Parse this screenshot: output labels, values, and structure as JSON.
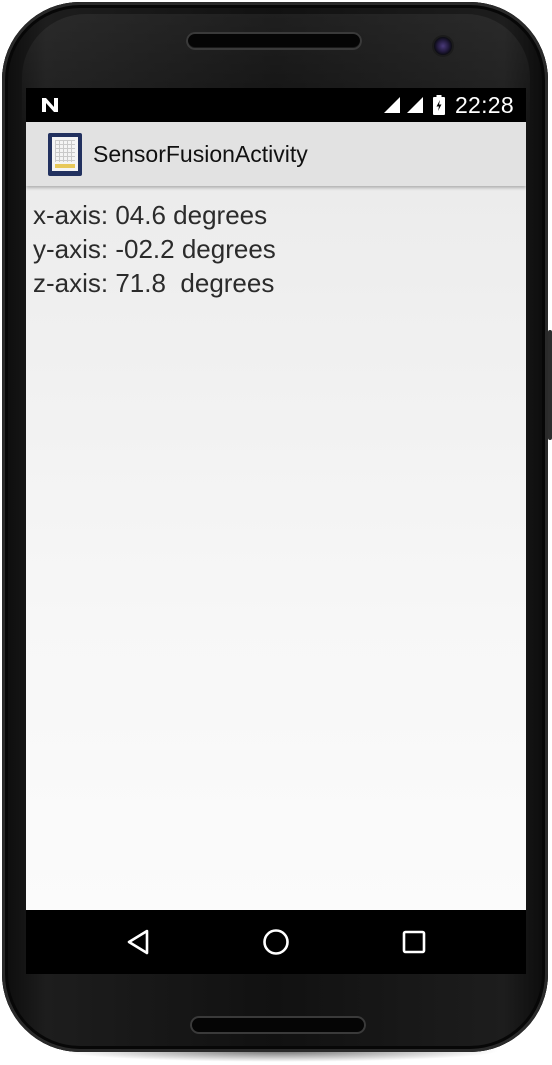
{
  "status_bar": {
    "time": "22:28"
  },
  "action_bar": {
    "title": "SensorFusionActivity"
  },
  "readings": {
    "x_axis": "x-axis: 04.6 degrees",
    "y_axis": "y-axis: -02.2 degrees",
    "z_axis": "z-axis: 71.8  degrees"
  },
  "icons": {
    "notification": "android-n-notification-icon",
    "signal": "cell-signal-icon",
    "battery": "battery-charging-icon",
    "app": "sensor-fusion-app-icon",
    "back": "back-triangle-icon",
    "home": "home-circle-icon",
    "recent": "recent-apps-square-icon"
  },
  "colors": {
    "action_bar": "#e2e2e2",
    "app_icon_frame": "#22315f",
    "text": "#2b2b2b",
    "status_bar": "#000000"
  }
}
